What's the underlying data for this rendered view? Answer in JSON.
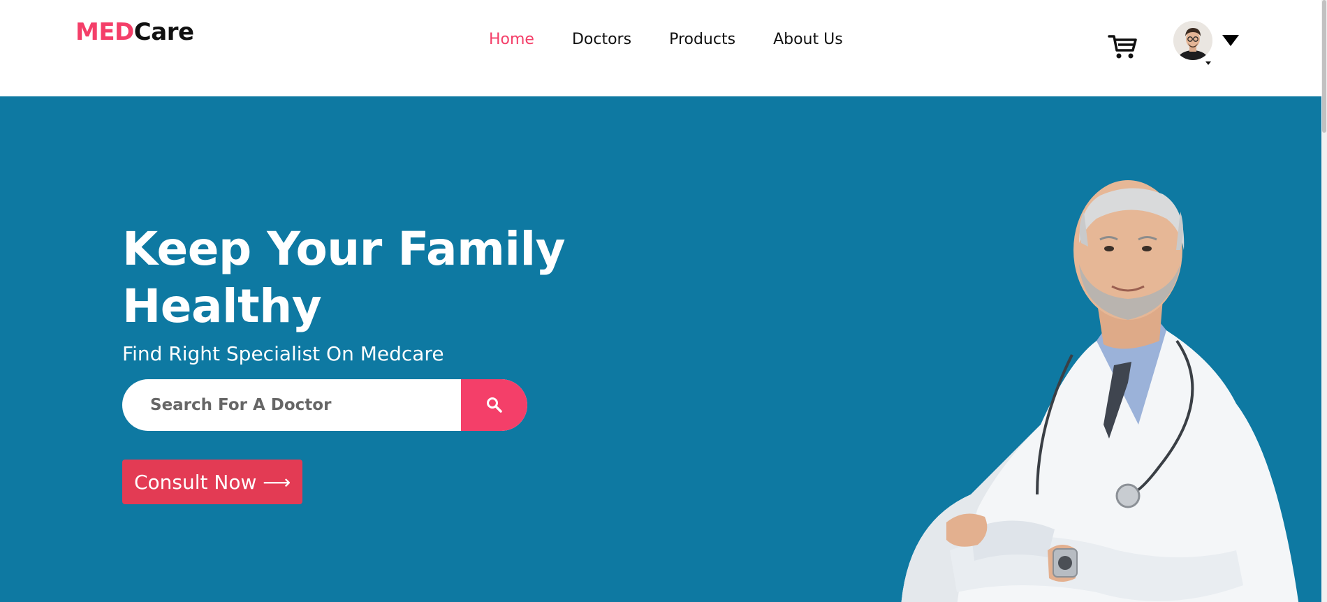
{
  "header": {
    "logo": {
      "part1": "MED",
      "part2": "Care"
    },
    "nav": [
      {
        "label": "Home",
        "active": true
      },
      {
        "label": "Doctors",
        "active": false
      },
      {
        "label": "Products",
        "active": false
      },
      {
        "label": "About Us",
        "active": false
      }
    ],
    "cart_icon": "cart-icon",
    "profile_icon": "avatar",
    "dropdown_icon": "triangle-down-icon"
  },
  "hero": {
    "title_line1": "Keep Your Family",
    "title_line2": "Healthy",
    "subtitle": "Find Right Specialist On Medcare",
    "search": {
      "placeholder": "Search For A Doctor",
      "value": ""
    },
    "search_icon": "search-icon",
    "consult_label": "Consult Now ⟶"
  },
  "colors": {
    "brand": "#f43f69",
    "hero_bg": "#0e79a2",
    "consult": "#e33b54",
    "text_dark": "#111111"
  }
}
